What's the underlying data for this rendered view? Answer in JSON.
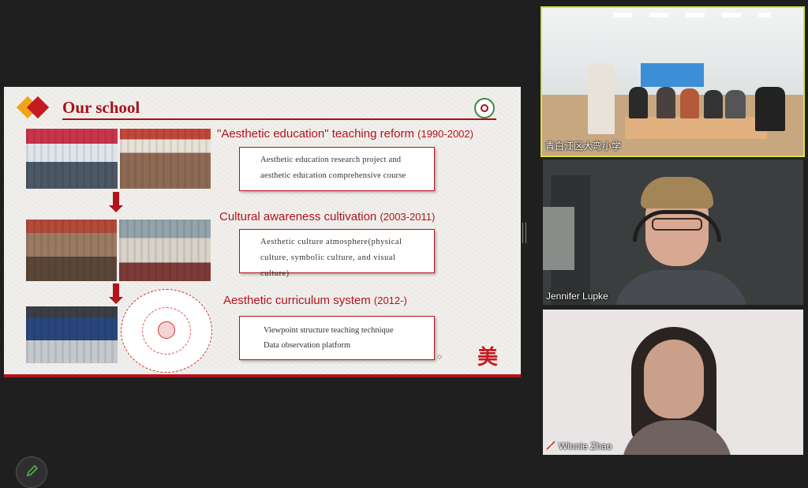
{
  "slide": {
    "title": "Our school",
    "sections": [
      {
        "heading": "\"Aesthetic education\" teaching reform",
        "years": "(1990-2002)",
        "lines": [
          "Aesthetic education research project and",
          "aesthetic education comprehensive course"
        ]
      },
      {
        "heading": "Cultural awareness cultivation",
        "years": "(2003-2011)",
        "lines": [
          "Aesthetic culture atmosphere(physical",
          "culture, symbolic culture, and visual culture)"
        ]
      },
      {
        "heading": "Aesthetic curriculum system",
        "years": "(2012-)",
        "lines": [
          "Viewpoint structure teaching technique",
          "Data observation platform"
        ]
      }
    ],
    "seal_char": "美",
    "accent_color": "#b3121b"
  },
  "participants": [
    {
      "name": "青白江区大弯小学",
      "active_speaker": true
    },
    {
      "name": "Jennifer Lupke",
      "muted": false
    },
    {
      "name": "Winnie Zhao",
      "muted": true
    }
  ],
  "controls": {
    "edit_icon": "pencil-icon"
  }
}
